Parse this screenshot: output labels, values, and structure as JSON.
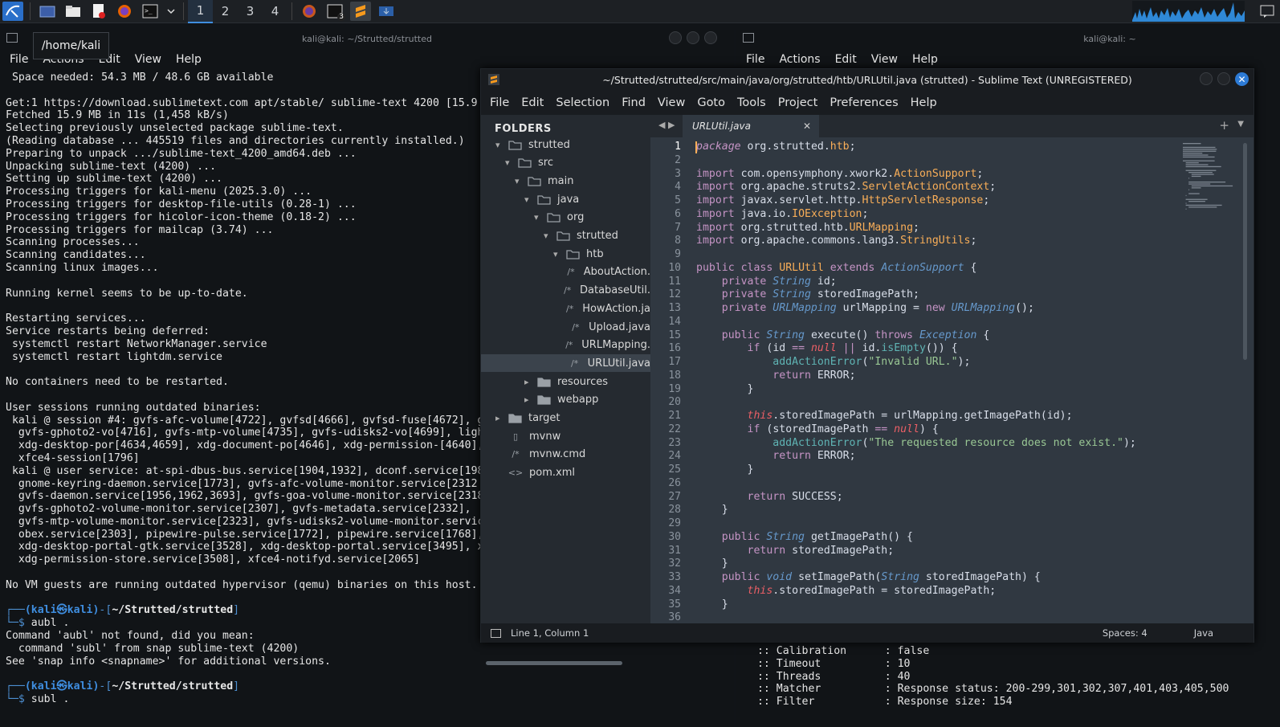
{
  "taskbar": {
    "workspaces": [
      "1",
      "2",
      "3",
      "4"
    ],
    "terminal_badge": "3"
  },
  "left_terminal": {
    "title": "kali@kali: ~/Strutted/strutted",
    "tooltip": "/home/kali",
    "menu": [
      "File",
      "Actions",
      "Edit",
      "View",
      "Help"
    ],
    "lines": [
      " Space needed: 54.3 MB / 48.6 GB available",
      "",
      "Get:1 https://download.sublimetext.com apt/stable/ sublime-text 4200 [15.9",
      "Fetched 15.9 MB in 11s (1,458 kB/s)",
      "Selecting previously unselected package sublime-text.",
      "(Reading database ... 445519 files and directories currently installed.)",
      "Preparing to unpack .../sublime-text_4200_amd64.deb ...",
      "Unpacking sublime-text (4200) ...",
      "Setting up sublime-text (4200) ...",
      "Processing triggers for kali-menu (2025.3.0) ...",
      "Processing triggers for desktop-file-utils (0.28-1) ...",
      "Processing triggers for hicolor-icon-theme (0.18-2) ...",
      "Processing triggers for mailcap (3.74) ...",
      "Scanning processes...",
      "Scanning candidates...",
      "Scanning linux images...",
      "",
      "Running kernel seems to be up-to-date.",
      "",
      "Restarting services...",
      "Service restarts being deferred:",
      " systemctl restart NetworkManager.service",
      " systemctl restart lightdm.service",
      "",
      "No containers need to be restarted.",
      "",
      "User sessions running outdated binaries:",
      " kali @ session #4: gvfs-afc-volume[4722], gvfsd[4666], gvfsd-fuse[4672], g",
      "  gvfs-gphoto2-vo[4716], gvfs-mtp-volume[4735], gvfs-udisks2-vo[4699], ligh",
      "  xdg-desktop-por[4634,4659], xdg-document-po[4646], xdg-permission-[4640],",
      "  xfce4-session[1796]",
      " kali @ user service: at-spi-dbus-bus.service[1904,1932], dconf.service[198",
      "  gnome-keyring-daemon.service[1773], gvfs-afc-volume-monitor.service[2312",
      "  gvfs-daemon.service[1956,1962,3693], gvfs-goa-volume-monitor.service[2318",
      "  gvfs-gphoto2-volume-monitor.service[2307], gvfs-metadata.service[2332],",
      "  gvfs-mtp-volume-monitor.service[2323], gvfs-udisks2-volume-monitor.servic",
      "  obex.service[2303], pipewire-pulse.service[1772], pipewire.service[1768],",
      "  xdg-desktop-portal-gtk.service[3528], xdg-desktop-portal.service[3495], x",
      "  xdg-permission-store.service[3508], xfce4-notifyd.service[2065]",
      "",
      "No VM guests are running outdated hypervisor (qemu) binaries on this host."
    ],
    "prompt1_user": "(kali㉿kali)",
    "prompt1_path": "~/Strutted/strutted",
    "cmd1": "aubl .",
    "after_lines": [
      "Command 'aubl' not found, did you mean:",
      "  command 'subl' from snap sublime-text (4200)",
      "See 'snap info <snapname>' for additional versions."
    ],
    "prompt2_user": "(kali㉿kali)",
    "prompt2_path": "~/Strutted/strutted",
    "cmd2": "subl ."
  },
  "right_terminal": {
    "title": "kali@kali: ~",
    "menu": [
      "File",
      "Actions",
      "Edit",
      "View",
      "Help"
    ],
    "lines": [
      " :: Calibration      : false",
      " :: Timeout          : 10",
      " :: Threads          : 40",
      " :: Matcher          : Response status: 200-299,301,302,307,401,403,405,500",
      " :: Filter           : Response size: 154"
    ]
  },
  "sublime": {
    "title": "~/Strutted/strutted/src/main/java/org/strutted/htb/URLUtil.java (strutted) - Sublime Text (UNREGISTERED)",
    "menu": [
      "File",
      "Edit",
      "Selection",
      "Find",
      "View",
      "Goto",
      "Tools",
      "Project",
      "Preferences",
      "Help"
    ],
    "sidebar_header": "FOLDERS",
    "tree": [
      {
        "label": "strutted",
        "icon": "folder-open"
      },
      {
        "label": "src",
        "icon": "folder-open"
      },
      {
        "label": "main",
        "icon": "folder-open"
      },
      {
        "label": "java",
        "icon": "folder-open"
      },
      {
        "label": "org",
        "icon": "folder-open"
      },
      {
        "label": "strutted",
        "icon": "folder-open"
      },
      {
        "label": "htb",
        "icon": "folder-open"
      },
      {
        "label": "AboutAction.",
        "icon": "java-file"
      },
      {
        "label": "DatabaseUtil.",
        "icon": "java-file"
      },
      {
        "label": "HowAction.ja",
        "icon": "java-file"
      },
      {
        "label": "Upload.java",
        "icon": "java-file"
      },
      {
        "label": "URLMapping.",
        "icon": "java-file"
      },
      {
        "label": "URLUtil.java",
        "icon": "java-file"
      },
      {
        "label": "resources",
        "icon": "folder-closed"
      },
      {
        "label": "webapp",
        "icon": "folder-closed"
      },
      {
        "label": "target",
        "icon": "folder-closed"
      },
      {
        "label": "mvnw",
        "icon": "file"
      },
      {
        "label": "mvnw.cmd",
        "icon": "java-file"
      },
      {
        "label": "pom.xml",
        "icon": "xml-file"
      }
    ],
    "tab_label": "URLUtil.java",
    "status_position": "Line 1, Column 1",
    "status_spaces": "Spaces: 4",
    "status_syntax": "Java",
    "code": [
      "package org.strutted.htb;",
      "",
      "import com.opensymphony.xwork2.ActionSupport;",
      "import org.apache.struts2.ServletActionContext;",
      "import javax.servlet.http.HttpServletResponse;",
      "import java.io.IOException;",
      "import org.strutted.htb.URLMapping;",
      "import org.apache.commons.lang3.StringUtils;",
      "",
      "public class URLUtil extends ActionSupport {",
      "    private String id;",
      "    private String storedImagePath;",
      "    private URLMapping urlMapping = new URLMapping();",
      "",
      "    public String execute() throws Exception {",
      "        if (id == null || id.isEmpty()) {",
      "            addActionError(\"Invalid URL.\");",
      "            return ERROR;",
      "        }",
      "",
      "        this.storedImagePath = urlMapping.getImagePath(id);",
      "        if (storedImagePath == null) {",
      "            addActionError(\"The requested resource does not exist.\");",
      "            return ERROR;",
      "        }",
      "",
      "        return SUCCESS;",
      "    }",
      "",
      "    public String getImagePath() {",
      "        return storedImagePath;",
      "    }",
      "    public void setImagePath(String storedImagePath) {",
      "        this.storedImagePath = storedImagePath;",
      "    }",
      ""
    ]
  }
}
